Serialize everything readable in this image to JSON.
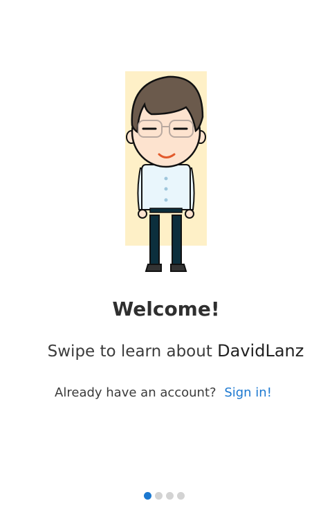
{
  "welcome": {
    "title": "Welcome!",
    "subtitle_prefix": "Swipe to learn about ",
    "brand": "DavidLanz"
  },
  "account": {
    "prompt": "Already have an account?",
    "signin_label": "Sign in!"
  },
  "pager": {
    "count": 4,
    "active_index": 0
  },
  "colors": {
    "accent": "#1b78d0",
    "illustration_bg": "#fef0c7"
  },
  "illustration": "avatar-illustration"
}
